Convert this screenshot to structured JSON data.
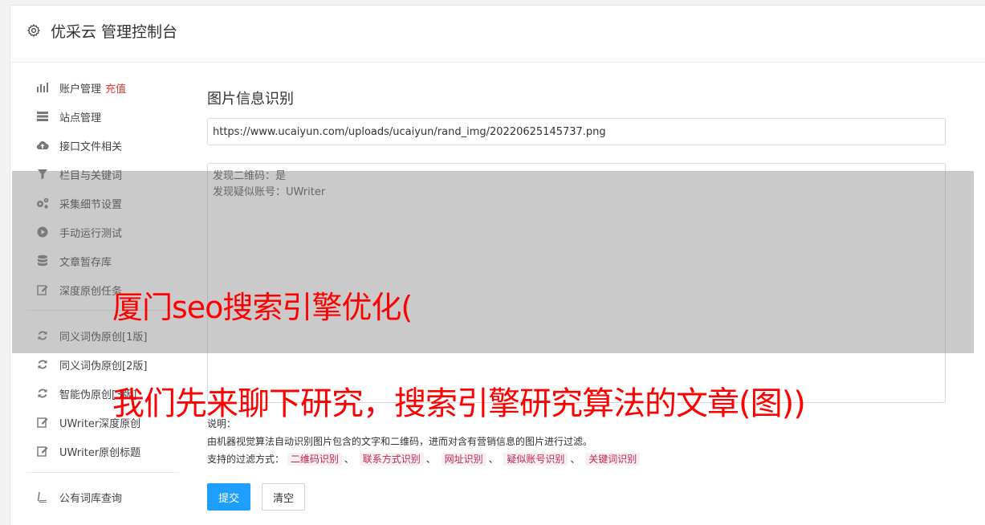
{
  "header": {
    "title": "优采云 管理控制台",
    "icon": "gear-icon"
  },
  "sidebar": {
    "items": [
      {
        "label": "账户管理",
        "extra": "充值",
        "icon": "bar-chart-icon"
      },
      {
        "label": "站点管理",
        "icon": "server-icon"
      },
      {
        "label": "接口文件相关",
        "icon": "cloud-upload-icon"
      },
      {
        "label": "栏目与关键词",
        "icon": "filter-icon"
      },
      {
        "label": "采集细节设置",
        "icon": "gears-icon"
      },
      {
        "label": "手动运行测试",
        "icon": "play-circle-icon"
      },
      {
        "label": "文章暂存库",
        "icon": "database-icon"
      },
      {
        "label": "深度原创任务",
        "icon": "edit-icon"
      },
      {
        "label": "同义词伪原创[1版]",
        "icon": "refresh-icon"
      },
      {
        "label": "同义词伪原创[2版]",
        "icon": "refresh-icon"
      },
      {
        "label": "智能伪原创[3版]",
        "icon": "refresh-icon"
      },
      {
        "label": "UWriter深度原创",
        "icon": "edit-icon"
      },
      {
        "label": "UWriter原创标题",
        "icon": "edit-icon"
      },
      {
        "label": "公有词库查询",
        "icon": "book-icon"
      }
    ]
  },
  "main": {
    "title": "图片信息识别",
    "url_value": "https://www.ucaiyun.com/uploads/ucaiyun/rand_img/20220625145737.png",
    "result_lines": [
      "发现二维码：是",
      "发现疑似账号：UWriter"
    ],
    "notes_label": "说明：",
    "notes_text": "由机器视觉算法自动识别图片包含的文字和二维码，进而对含有营销信息的图片进行过滤。",
    "filter_label": "支持的过滤方式：",
    "filter_tags": [
      "二维码识别",
      "联系方式识别",
      "网址识别",
      "疑似账号识别",
      "关键词识别"
    ],
    "submit_label": "提交",
    "clear_label": "清空"
  },
  "overlay": {
    "line1": "厦门seo搜索引擎优化(",
    "line2": "我们先来聊下研究，搜索引擎研究算法的文章(图))"
  },
  "colors": {
    "primary": "#1e9fff",
    "accent_red": "#e53935",
    "overlay_text": "#ff0000"
  }
}
